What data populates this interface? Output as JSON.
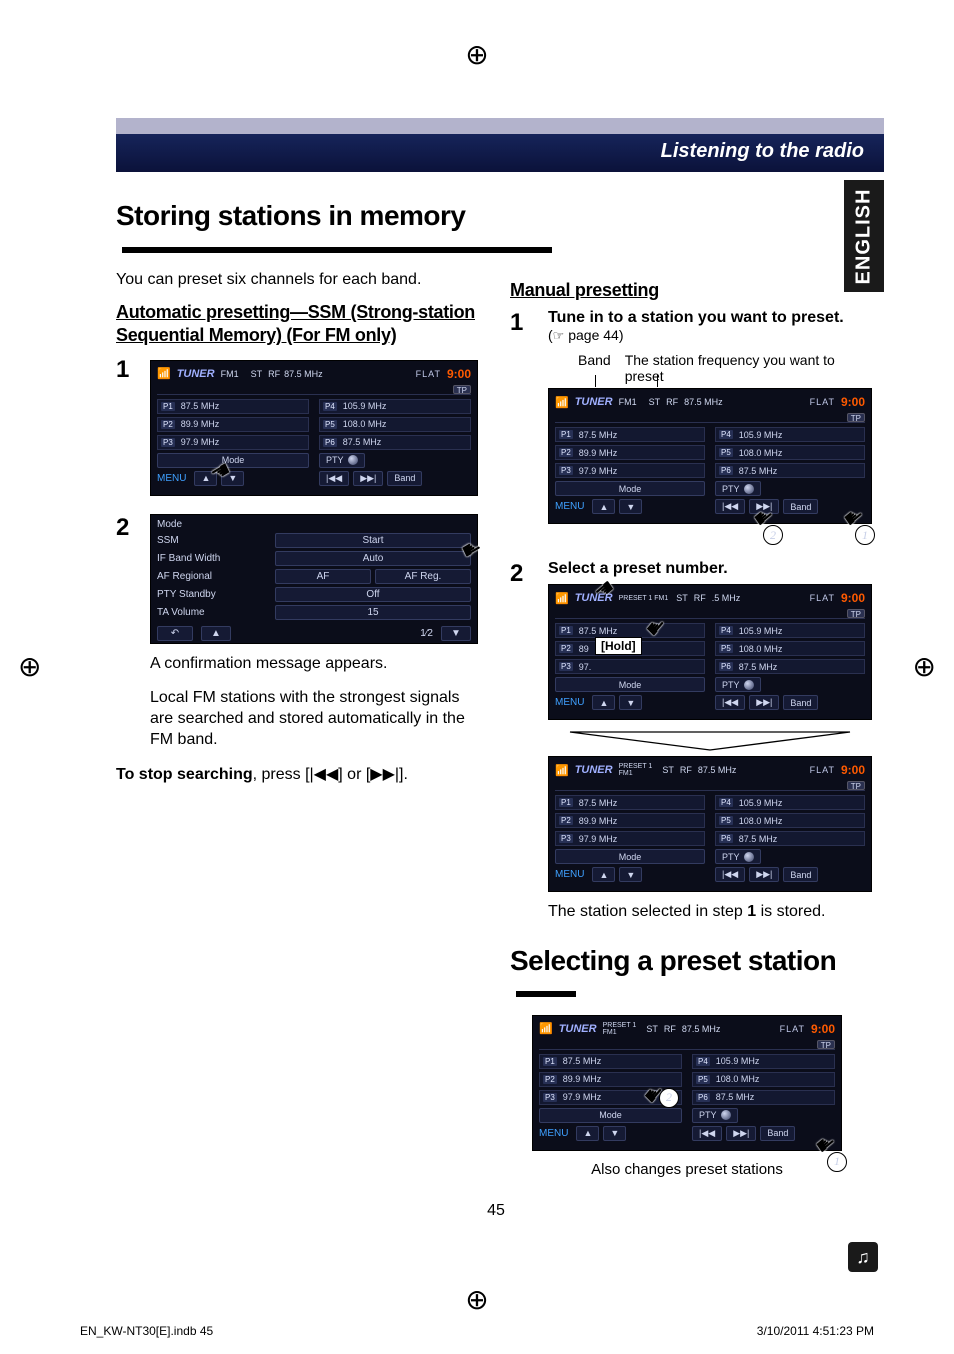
{
  "header": {
    "section_title": "Listening to the radio",
    "language_tab": "ENGLISH"
  },
  "headings": {
    "storing": "Storing stations in memory",
    "selecting": "Selecting a preset station"
  },
  "intro": "You can preset six channels for each band.",
  "auto_presetting": {
    "title": "Automatic presetting—SSM (Strong-station Sequential Memory) (For FM only)",
    "confirmation": "A confirmation message appears.",
    "search_note": "Local FM stations with the strongest signals are searched and stored automatically in the FM band.",
    "stop_label": "To stop searching",
    "stop_rest": ", press [|◀◀] or [▶▶|]."
  },
  "manual_presetting": {
    "title": "Manual presetting",
    "step1_title": "Tune in to a station you want to preset.",
    "step1_ref": "page 44",
    "label_band": "Band",
    "label_freq": "The station frequency you want to preset",
    "step2_title": "Select a preset number.",
    "hold_label": "[Hold]",
    "step2_result_a": "The station selected in step ",
    "step2_result_num": "1",
    "step2_result_b": " is stored."
  },
  "selecting_caption": "Also changes preset stations",
  "device_common": {
    "source": "TUNER",
    "band": "FM1",
    "band_preset": "PRESET 1\nFM1",
    "st": "ST",
    "rf": "RF",
    "freq_top": "87.5  MHz",
    "flat": "FLAT",
    "time": "9:00",
    "tp": "TP",
    "presets": [
      {
        "p": "P1",
        "v": "87.5 MHz"
      },
      {
        "p": "P2",
        "v": "89.9 MHz"
      },
      {
        "p": "P3",
        "v": "97.9 MHz"
      },
      {
        "p": "P4",
        "v": "105.9 MHz"
      },
      {
        "p": "P5",
        "v": "108.0 MHz"
      },
      {
        "p": "P6",
        "v": "87.5 MHz"
      }
    ],
    "mode": "Mode",
    "pty": "PTY",
    "menu": "MENU",
    "band_btn": "Band"
  },
  "mode_menu": {
    "title": "Mode",
    "rows": [
      {
        "label": "SSM",
        "value": "Start"
      },
      {
        "label": "IF Band Width",
        "value": "Auto"
      },
      {
        "label": "AF Regional",
        "value_a": "AF",
        "value_b": "AF Reg."
      },
      {
        "label": "PTY Standby",
        "value": "Off"
      },
      {
        "label": "TA Volume",
        "value": "15"
      }
    ],
    "pager": "1⁄2"
  },
  "page_number": "45",
  "footer": {
    "file": "EN_KW-NT30[E].indb   45",
    "timestamp": "3/10/2011   4:51:23 PM"
  },
  "chart_data": null
}
